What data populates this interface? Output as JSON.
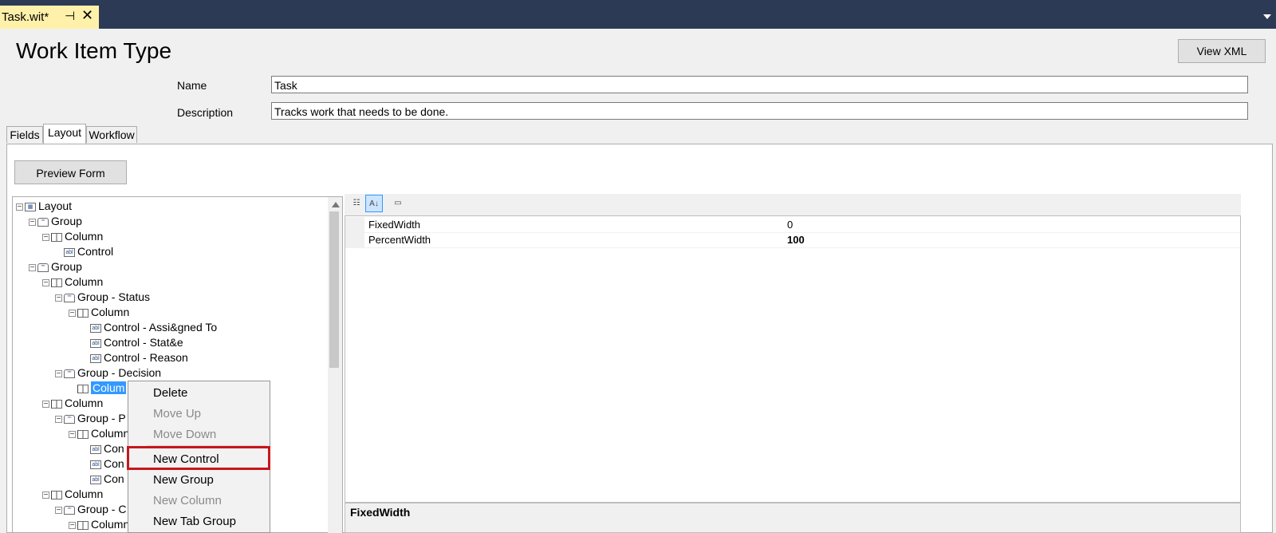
{
  "window": {
    "doc_tab_title": "Task.wit*",
    "pin_glyph": "⊣",
    "close_glyph": "✕"
  },
  "header": {
    "title": "Work Item Type",
    "view_xml_label": "View XML"
  },
  "form": {
    "name_label": "Name",
    "name_value": "Task",
    "description_label": "Description",
    "description_value": "Tracks work that needs to be done."
  },
  "tabs": [
    {
      "label": "Fields",
      "active": false
    },
    {
      "label": "Layout",
      "active": true
    },
    {
      "label": "Workflow",
      "active": false
    }
  ],
  "layout_tab": {
    "preview_label": "Preview Form"
  },
  "tree": {
    "nodes": [
      {
        "label": "Layout",
        "type": "layout"
      },
      {
        "label": "Group",
        "type": "group"
      },
      {
        "label": "Column",
        "type": "column"
      },
      {
        "label": "Control",
        "type": "control"
      },
      {
        "label": "Group",
        "type": "group"
      },
      {
        "label": "Column",
        "type": "column"
      },
      {
        "label": "Group - Status",
        "type": "group"
      },
      {
        "label": "Column",
        "type": "column"
      },
      {
        "label": "Control - Assi&gned To",
        "type": "control"
      },
      {
        "label": "Control - Stat&e",
        "type": "control"
      },
      {
        "label": "Control - Reason",
        "type": "control"
      },
      {
        "label": "Group - Decision",
        "type": "group"
      },
      {
        "label": "Colum",
        "type": "column",
        "selected": true
      },
      {
        "label": "Column",
        "type": "column"
      },
      {
        "label": "Group - P",
        "type": "group"
      },
      {
        "label": "Column",
        "type": "column"
      },
      {
        "label": "Con",
        "type": "control"
      },
      {
        "label": "Con",
        "type": "control"
      },
      {
        "label": "Con",
        "type": "control"
      },
      {
        "label": "Column",
        "type": "column"
      },
      {
        "label": "Group - C",
        "type": "group"
      },
      {
        "label": "Column",
        "type": "column"
      }
    ]
  },
  "properties": {
    "toolbar": [
      "categorized-icon",
      "alphabetical-icon",
      "property-pages-icon"
    ],
    "rows": [
      {
        "name": "FixedWidth",
        "value": "0",
        "bold": false
      },
      {
        "name": "PercentWidth",
        "value": "100",
        "bold": true
      }
    ],
    "description_title": "FixedWidth"
  },
  "context_menu": {
    "items": [
      {
        "label": "Delete",
        "enabled": true
      },
      {
        "label": "Move Up",
        "enabled": false
      },
      {
        "label": "Move Down",
        "enabled": false
      },
      {
        "label": "New Control",
        "enabled": true,
        "highlighted": true
      },
      {
        "label": "New Group",
        "enabled": true
      },
      {
        "label": "New Column",
        "enabled": false
      },
      {
        "label": "New Tab Group",
        "enabled": true
      }
    ],
    "highlight_color": "#c6171b"
  },
  "colors": {
    "title_bar": "#2d3a56",
    "doc_tab": "#fff1a9",
    "selection": "#3399ff"
  }
}
